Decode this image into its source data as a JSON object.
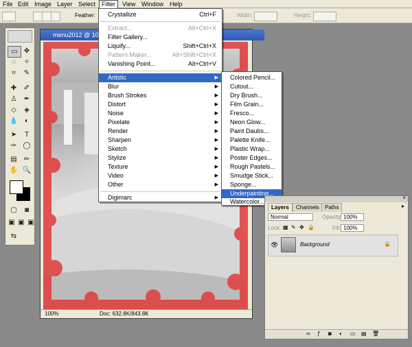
{
  "menubar": {
    "items": [
      "File",
      "Edit",
      "Image",
      "Layer",
      "Select",
      "Filter",
      "View",
      "Window",
      "Help"
    ],
    "active": "Filter"
  },
  "options": {
    "feather_label": "Feather:",
    "width_label": "Width:",
    "height_label": "Height:"
  },
  "filter_menu": {
    "top": {
      "label": "Crystallize",
      "shortcut": "Ctrl+F"
    },
    "group1": [
      {
        "label": "Extract...",
        "shortcut": "Alt+Ctrl+X",
        "disabled": true
      },
      {
        "label": "Filter Gallery...",
        "shortcut": "",
        "disabled": false
      },
      {
        "label": "Liquify...",
        "shortcut": "Shift+Ctrl+X",
        "disabled": false
      },
      {
        "label": "Pattern Maker...",
        "shortcut": "Alt+Shift+Ctrl+X",
        "disabled": true
      },
      {
        "label": "Vanishing Point...",
        "shortcut": "Alt+Ctrl+V",
        "disabled": false
      }
    ],
    "submenus": [
      "Artistic",
      "Blur",
      "Brush Strokes",
      "Distort",
      "Noise",
      "Pixelate",
      "Render",
      "Sharpen",
      "Sketch",
      "Stylize",
      "Texture",
      "Video",
      "Other"
    ],
    "highlighted": "Artistic",
    "bottom": {
      "label": "Digimarc"
    }
  },
  "artistic_submenu": {
    "items": [
      "Colored Pencil...",
      "Cutout...",
      "Dry Brush...",
      "Film Grain...",
      "Fresco...",
      "Neon Glow...",
      "Paint Daubs...",
      "Palette Knife...",
      "Plastic Wrap...",
      "Poster Edges...",
      "Rough Pastels...",
      "Smudge Stick...",
      "Sponge...",
      "Underpainting...",
      "Watercolor..."
    ],
    "highlighted": "Underpainting..."
  },
  "document": {
    "title": "menu2012 @ 10",
    "zoom": "100%",
    "doc_size": "Doc: 632.8K/843.8K"
  },
  "layers": {
    "tabs": [
      "Layers",
      "Channels",
      "Paths"
    ],
    "blend_mode": "Normal",
    "opacity_label": "Opacity:",
    "opacity": "100%",
    "lock_label": "Lock:",
    "fill_label": "Fill:",
    "fill": "100%",
    "layer_name": "Background"
  },
  "colors": {
    "highlight": "#316ac5",
    "chrome": "#ece9d8",
    "mask_red": "#e23b3b"
  }
}
